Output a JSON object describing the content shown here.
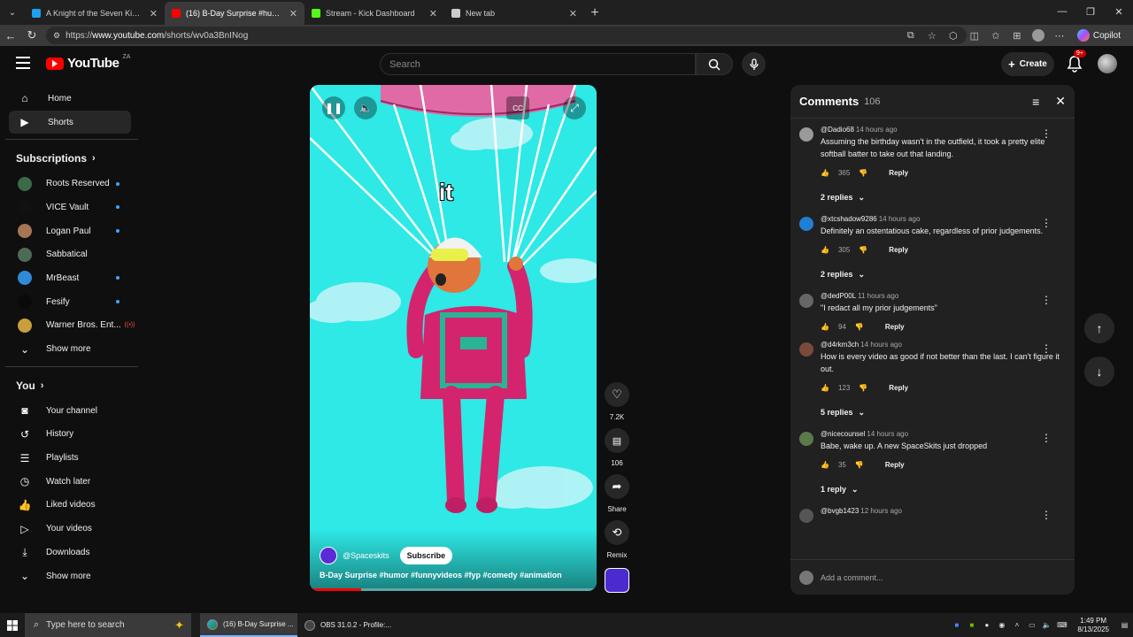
{
  "browser": {
    "tabs": [
      {
        "title": "A Knight of the Seven Kingdoms -",
        "active": false,
        "favicon_color": "#1da1f2"
      },
      {
        "title": "(16) B-Day Surprise #humor #",
        "active": true,
        "favicon_color": "#ff0000"
      },
      {
        "title": "Stream - Kick Dashboard",
        "active": false,
        "favicon_color": "#53fc18"
      },
      {
        "title": "New tab",
        "active": false,
        "favicon_color": "#cccccc"
      }
    ],
    "url_prefix": "https://",
    "url_host": "www.youtube.com",
    "url_path": "/shorts/wv0a3BnINog",
    "profile_label": "Copilot"
  },
  "youtube": {
    "logo_text": "YouTube",
    "logo_country": "ZA",
    "search_placeholder": "Search",
    "create_label": "Create",
    "notif_badge": "9+"
  },
  "sidebar": {
    "main": [
      {
        "label": "Home",
        "icon": "home-icon",
        "active": false
      },
      {
        "label": "Shorts",
        "icon": "shorts-icon",
        "active": true
      }
    ],
    "subscriptions_header": "Subscriptions",
    "subscriptions": [
      {
        "label": "Roots Reserved",
        "color": "#3a6b46",
        "dot": true,
        "live": ""
      },
      {
        "label": "VICE Vault",
        "color": "#111111",
        "dot": true,
        "live": ""
      },
      {
        "label": "Logan Paul",
        "color": "#a87552",
        "dot": true,
        "live": ""
      },
      {
        "label": "Sabbatical",
        "color": "#4d6a54",
        "dot": false,
        "live": ""
      },
      {
        "label": "MrBeast",
        "color": "#2f8bd6",
        "dot": true,
        "live": ""
      },
      {
        "label": "Fesify",
        "color": "#0a0a0a",
        "dot": true,
        "live": ""
      },
      {
        "label": "Warner Bros. Ent...",
        "color": "#c89f3a",
        "dot": false,
        "live": "((•))"
      }
    ],
    "show_more_1": "Show more",
    "you_header": "You",
    "you_items": [
      {
        "label": "Your channel",
        "icon": "channel-icon"
      },
      {
        "label": "History",
        "icon": "history-icon"
      },
      {
        "label": "Playlists",
        "icon": "playlists-icon"
      },
      {
        "label": "Watch later",
        "icon": "watch-later-icon"
      },
      {
        "label": "Liked videos",
        "icon": "like-icon"
      },
      {
        "label": "Your videos",
        "icon": "your-videos-icon"
      },
      {
        "label": "Downloads",
        "icon": "download-icon"
      }
    ],
    "show_more_2": "Show more"
  },
  "video": {
    "caption": "it",
    "channel": "@Spaceskits",
    "subscribe_label": "Subscribe",
    "title": "B-Day Surprise #humor #funnyvideos #fyp #comedy #animation",
    "progress": 0.18,
    "colors": {
      "sky": "#2ee9e6",
      "suit": "#d4246e",
      "parachute": "#e06aa6"
    }
  },
  "actions": {
    "likes": "7.2K",
    "comments": "106",
    "share": "Share",
    "remix": "Remix"
  },
  "comments": {
    "title": "Comments",
    "count": "106",
    "items": [
      {
        "user": "@Dadio68",
        "time": "14 hours ago",
        "text": "Assuming the birthday wasn't in the outfield, it took a pretty elite softball batter to take out that landing.",
        "likes": "365",
        "replies": "2 replies",
        "avatar": "#9a9a9a"
      },
      {
        "user": "@xtcshadow9286",
        "time": "14 hours ago",
        "text": "Definitely an ostentatious cake, regardless of prior judgements.",
        "likes": "305",
        "replies": "2 replies",
        "avatar": "#1e7fd6"
      },
      {
        "user": "@dedP00L",
        "time": "11 hours ago",
        "text": "\"I redact all my prior judgements\"",
        "likes": "94",
        "replies": "",
        "avatar": "#666666"
      },
      {
        "user": "@d4rkm3ch",
        "time": "14 hours ago",
        "text": "How is every video as good if not better than the last. I can't figure it out.",
        "likes": "123",
        "replies": "5 replies",
        "avatar": "#7a4a3a"
      },
      {
        "user": "@nicecounsel",
        "time": "14 hours ago",
        "text": "Babe, wake up. A new SpaceSkits just dropped",
        "likes": "35",
        "replies": "1 reply",
        "avatar": "#5a7a4a"
      },
      {
        "user": "@bvgb1423",
        "time": "12 hours ago",
        "text": "",
        "likes": "",
        "replies": "",
        "avatar": "#555555"
      }
    ],
    "reply_label": "Reply",
    "add_placeholder": "Add a comment..."
  },
  "taskbar": {
    "search_placeholder": "Type here to search",
    "apps": [
      {
        "label": "(16) B-Day Surprise ...",
        "active": true
      },
      {
        "label": "OBS 31.0.2 - Profile:...",
        "active": false
      }
    ],
    "time": "1:49 PM",
    "date": "8/13/2025"
  }
}
